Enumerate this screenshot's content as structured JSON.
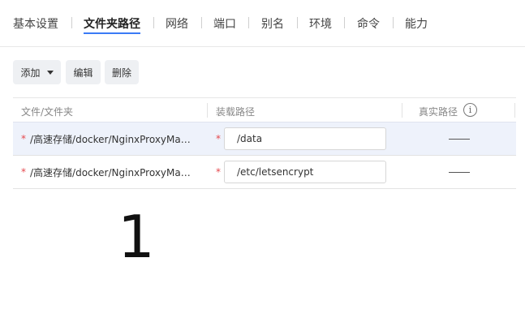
{
  "tabs": [
    {
      "label": "基本设置"
    },
    {
      "label": "文件夹路径",
      "active": true
    },
    {
      "label": "网络"
    },
    {
      "label": "端口"
    },
    {
      "label": "别名"
    },
    {
      "label": "环境"
    },
    {
      "label": "命令"
    },
    {
      "label": "能力"
    }
  ],
  "toolbar": {
    "add_label": "添加",
    "edit_label": "编辑",
    "delete_label": "删除"
  },
  "table": {
    "headers": {
      "file": "文件/文件夹",
      "mount": "装载路径",
      "real": "真实路径"
    },
    "info_icon": "i",
    "rows": [
      {
        "required": "*",
        "path": "/高速存储/docker/NginxProxyManager/data",
        "mount_required": "*",
        "mount": "/data",
        "selected": true
      },
      {
        "required": "*",
        "path": "/高速存储/docker/NginxProxyManager/letsencrypt",
        "mount_required": "*",
        "mount": "/etc/letsencrypt",
        "selected": false
      }
    ]
  },
  "annotation": "1",
  "colors": {
    "accent": "#3b7bf6",
    "required": "#e5484d",
    "selected_row": "#eef2fb"
  }
}
